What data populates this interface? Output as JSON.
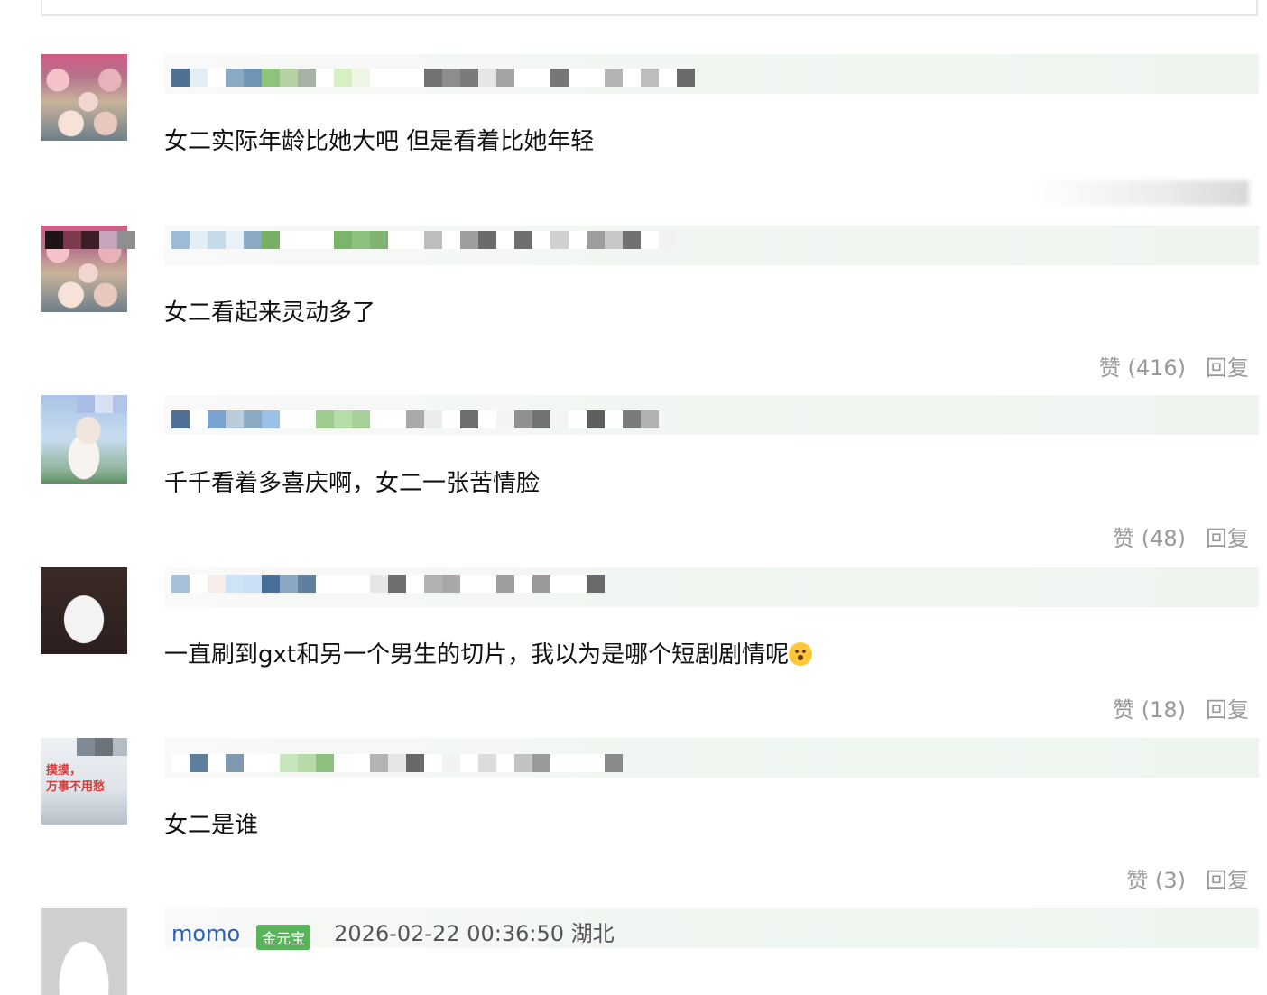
{
  "comments": [
    {
      "text": "女二实际年龄比她大吧 但是看着比她年轻",
      "likes": "",
      "reply": "",
      "avatar": "flowers-avatar"
    },
    {
      "text": "女二看起来灵动多了",
      "likes": "赞 (416)",
      "reply": "回复",
      "avatar": "flowers-avatar"
    },
    {
      "text": "千千看着多喜庆啊，女二一张苦情脸",
      "likes": "赞 (48)",
      "reply": "回复",
      "avatar": "girl-avatar"
    },
    {
      "text": "一直刷到gxt和另一个男生的切片，我以为是哪个短剧剧情呢",
      "likes": "赞 (18)",
      "reply": "回复",
      "avatar": "cat-avatar",
      "emoji": "hushed-face-emoji"
    },
    {
      "text": "女二是谁",
      "likes": "赞 (3)",
      "reply": "回复",
      "avatar": "sign-avatar",
      "avatar_text": "摸摸，\n万事不用愁"
    }
  ],
  "last_comment": {
    "username": "momo",
    "badge": "金元宝",
    "meta": "2026-02-22 00:36:50 湖北"
  },
  "colors": {
    "username_blue": "#2a60b8",
    "badge_green": "#58b35a",
    "action_gray": "#999999"
  }
}
